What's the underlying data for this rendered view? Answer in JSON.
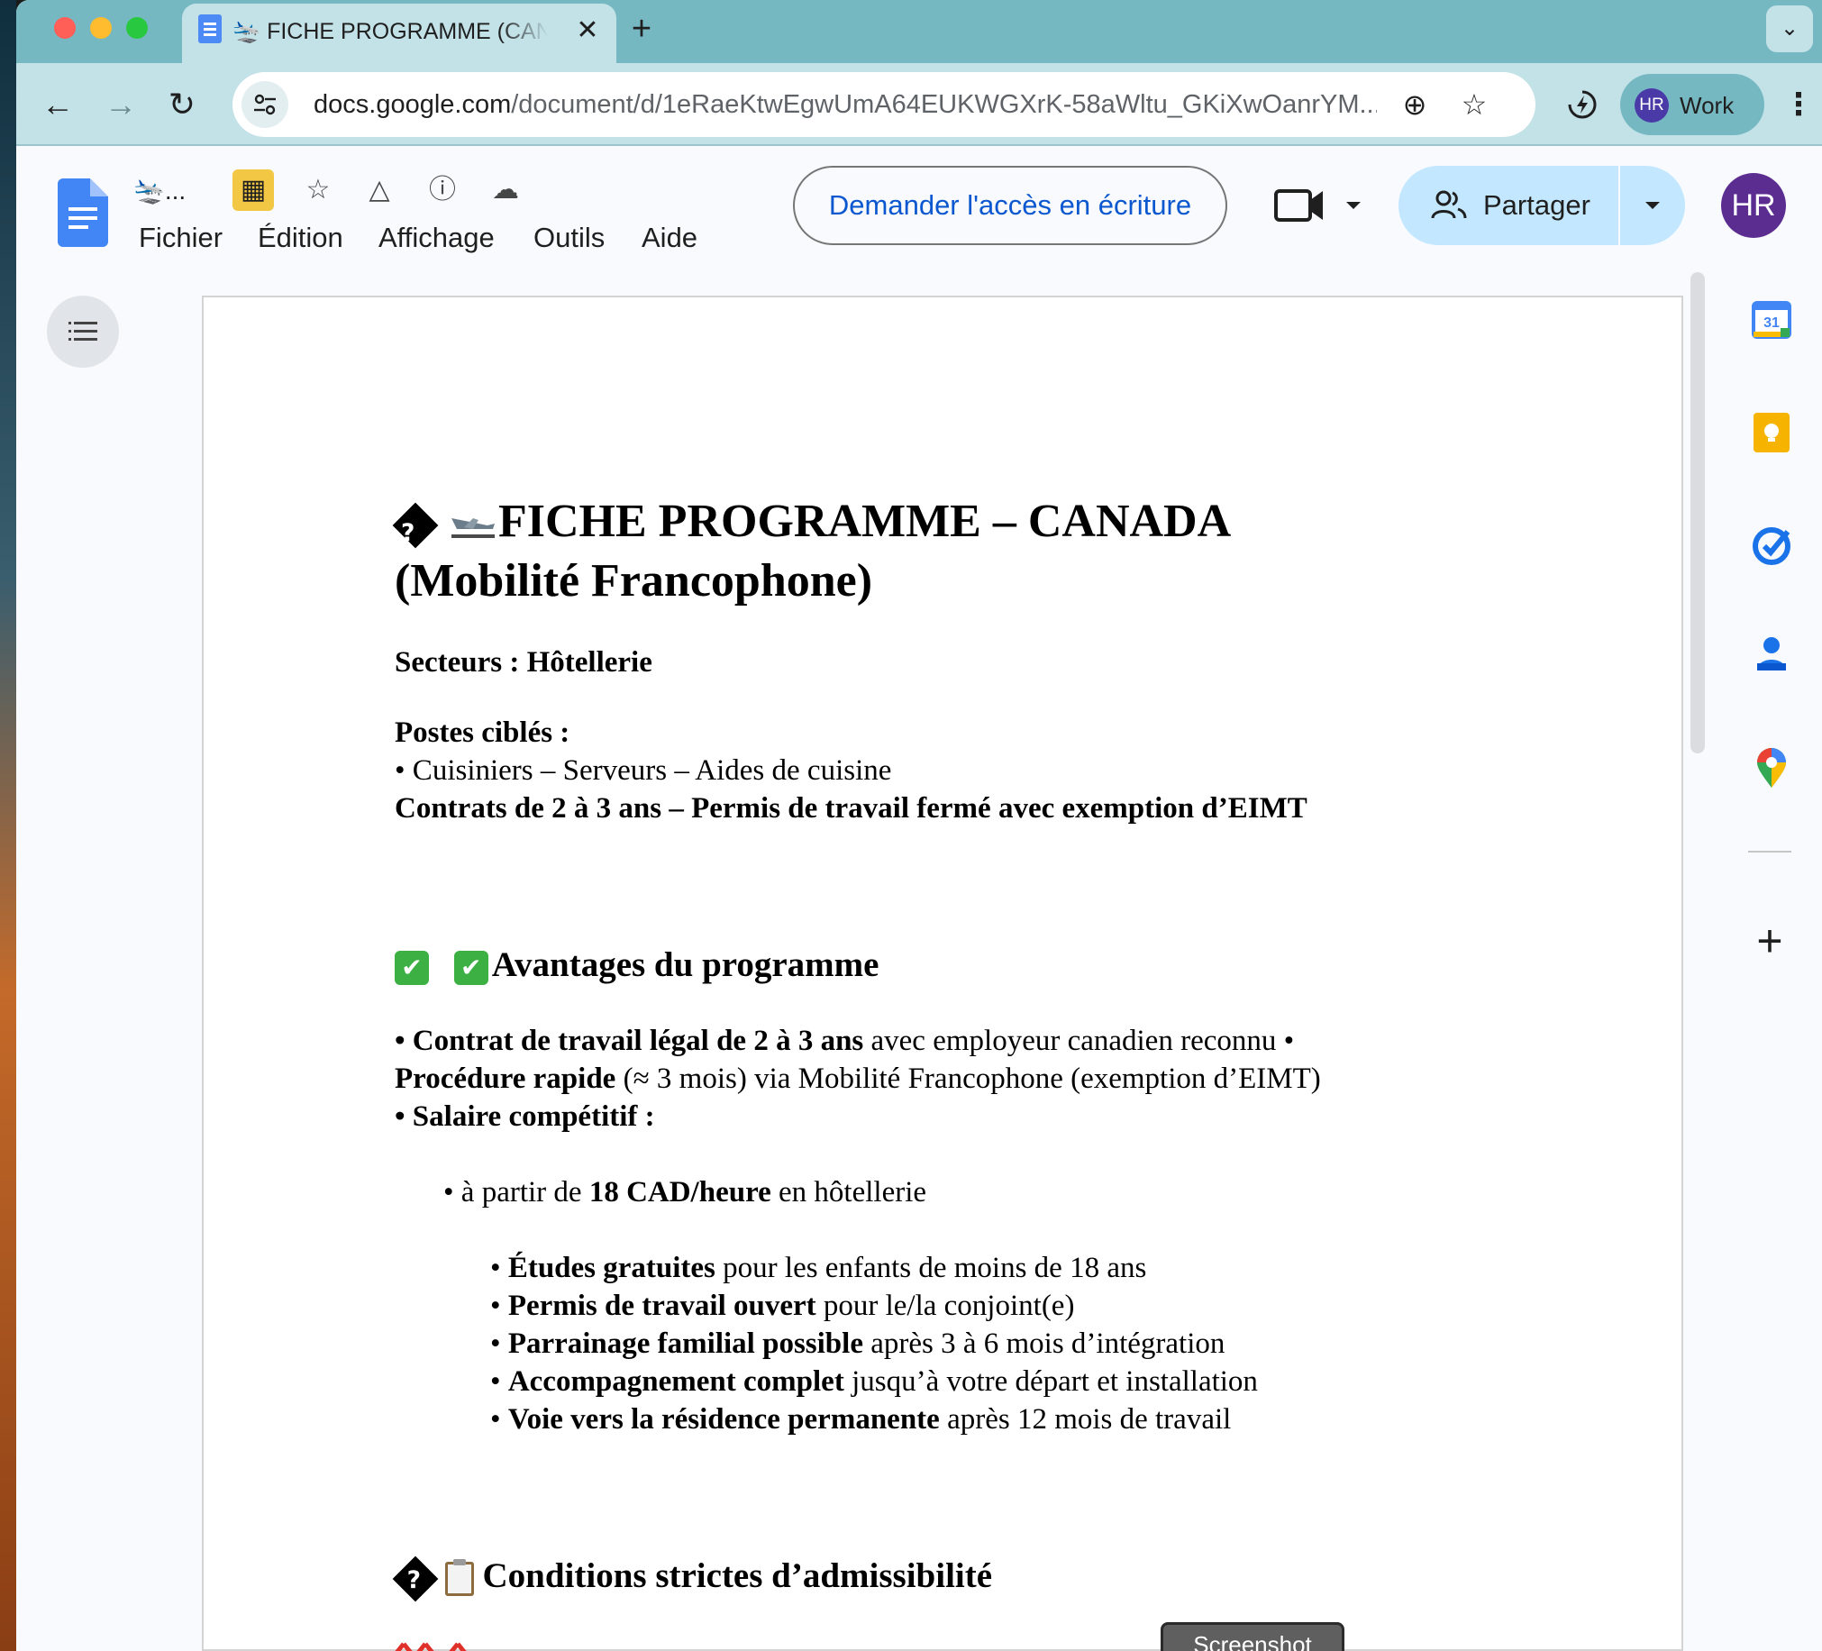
{
  "browser": {
    "tab": {
      "title": "🛬 FICHE PROGRAMME (CANADA",
      "close_glyph": "✕",
      "favicon": "docs-favicon-icon"
    },
    "new_tab_glyph": "+",
    "tab_search_glyph": "⌄",
    "nav": {
      "back_glyph": "←",
      "forward_glyph": "→",
      "reload_glyph": "↻"
    },
    "url": {
      "host": "docs.google.com",
      "path": "/document/d/1eRaeKtwEgwUmA64EUKWGXrK-58aWltu_GKiXwOanrYM..."
    },
    "zoom_glyph": "⊕",
    "bookmark_glyph": "☆",
    "profile": {
      "initials": "HR",
      "name": "Work"
    },
    "menu_glyph": "⋮"
  },
  "docs": {
    "doc_title": "🛬...",
    "menu": [
      "Fichier",
      "Édition",
      "Affichage",
      "Outils",
      "Aide"
    ],
    "title_icons": [
      "no-edit-icon",
      "star-icon",
      "move-to-drive-icon",
      "details-icon",
      "cloud-sync-icon"
    ],
    "title_icon_glyphs": [
      "▦",
      "☆",
      "△",
      "ⓘ",
      "☁"
    ],
    "request_access_label": "Demander l'accès en écriture",
    "share_label": "Partager",
    "account_initials": "HR",
    "screenshot_label": "Screenshot"
  },
  "side_panel": {
    "calendar_day": "31",
    "add_glyph": "+"
  },
  "document": {
    "title_line1": "FICHE PROGRAMME – CANADA",
    "title_line2": "(Mobilité  Francophone)",
    "replacement_char": "?",
    "sectors": "Secteurs : Hôtellerie",
    "postes_heading": "Postes ciblés :",
    "postes_list": "• Cuisiniers – Serveurs – Aides de cuisine",
    "contrats": "Contrats de 2 à 3 ans – Permis de travail fermé avec exemption d’EIMT",
    "avantages_heading": "Avantages du programme",
    "check_glyph": "✔",
    "adv_line1_bold": "• Contrat de travail légal de 2 à 3 ans",
    "adv_line1_rest": " avec employeur canadien reconnu •",
    "adv_line2_bold": "Procédure rapide",
    "adv_line2_rest": " (≈ 3 mois) via Mobilité Francophone (exemption d’EIMT)",
    "adv_line3_bold": "• Salaire compétitif :",
    "salary_prefix": "• à partir de ",
    "salary_bold": "18 CAD/heure",
    "salary_suffix": " en hôtellerie",
    "benefits": [
      {
        "bullet": "• ",
        "bold": "Études gratuites",
        "rest": " pour les enfants de moins de 18 ans"
      },
      {
        "bullet": "• ",
        "bold": "Permis de travail ouvert",
        "rest": " pour le/la conjoint(e)"
      },
      {
        "bullet": "• ",
        "bold": "Parrainage familial possible",
        "rest": " après 3 à 6 mois d’intégration"
      },
      {
        "bullet": "• ",
        "bold": "Accompagnement complet",
        "rest": " jusqu’à votre départ et installation"
      },
      {
        "bullet": "• ",
        "bold": "Voie vers la résidence permanente",
        "rest": " après 12 mois de travail"
      }
    ],
    "conditions_heading": "Conditions strictes d’admissibilité"
  }
}
